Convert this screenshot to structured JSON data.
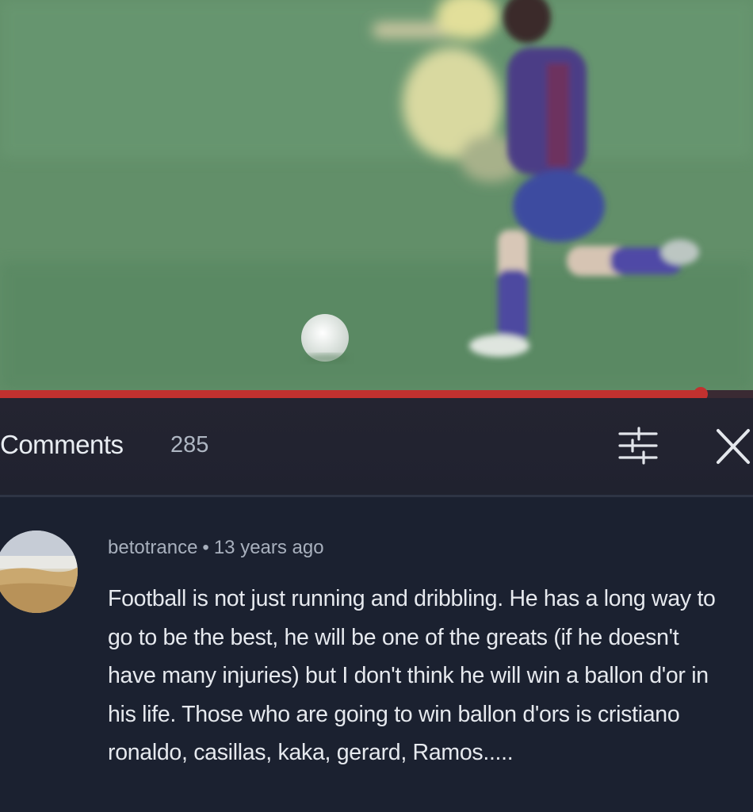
{
  "player": {
    "progress_fraction": 0.93,
    "progress_color": "#c2312f"
  },
  "comments_header": {
    "title": "Comments",
    "count": "285",
    "sort_icon": "sort-filter-icon",
    "close_icon": "close-icon"
  },
  "comment": {
    "author": "betotrance",
    "separator": "•",
    "time": "13 years ago",
    "text": "Football is not just running and dribbling. He has a long way to go to be the best, he will be one of the greats (if he doesn't have many injuries) but I don't think he will win a ballon d'or in his life. Those who are going to win ballon d'ors is cristiano ronaldo, casillas, kaka, gerard, Ramos....."
  }
}
